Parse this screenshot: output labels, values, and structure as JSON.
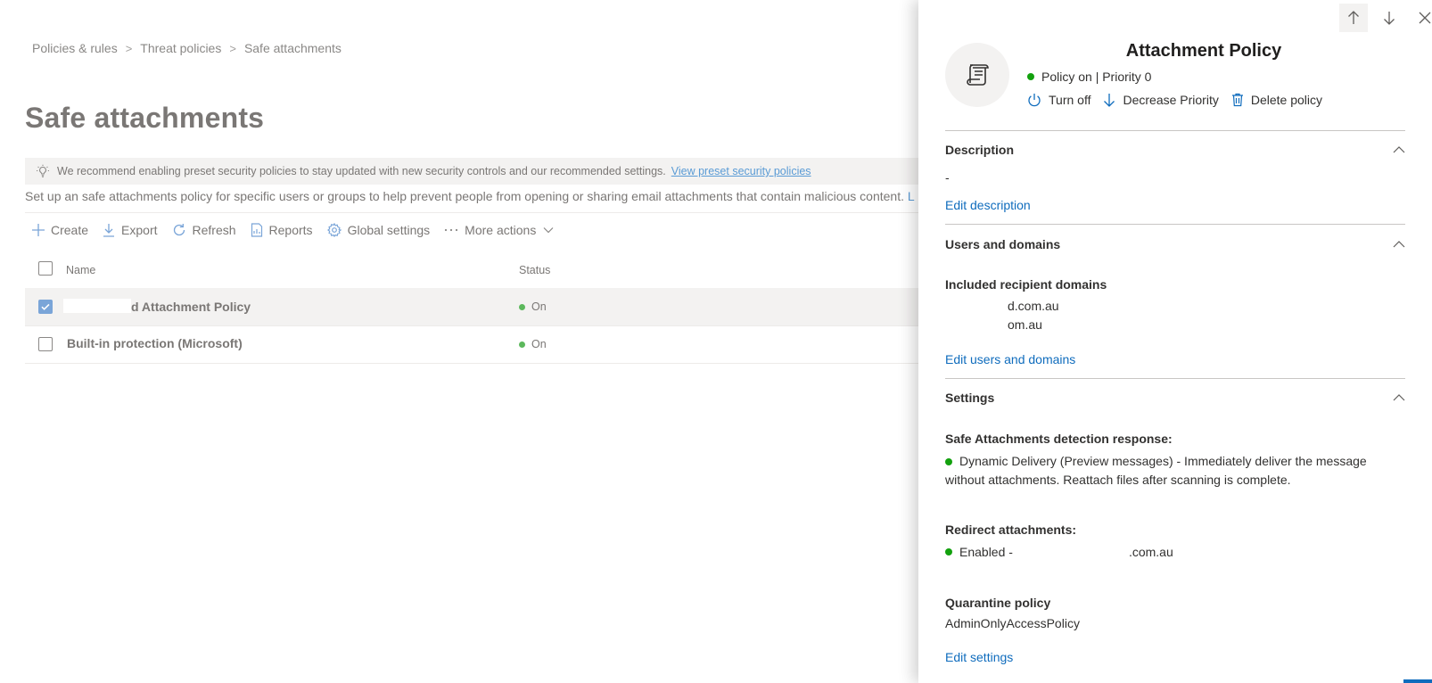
{
  "breadcrumb": {
    "items": [
      "Policies & rules",
      "Threat policies",
      "Safe attachments"
    ]
  },
  "page": {
    "title": "Safe attachments",
    "notice_text": "We recommend enabling preset security policies to stay updated with new security controls and our recommended settings.",
    "notice_link": "View preset security policies",
    "description": "Set up an safe attachments policy for specific users or groups to help prevent people from opening or sharing email attachments that contain malicious content.",
    "description_link": "L"
  },
  "toolbar": {
    "create": "Create",
    "export": "Export",
    "refresh": "Refresh",
    "reports": "Reports",
    "global_settings": "Global settings",
    "more_actions": "More actions"
  },
  "table": {
    "headers": {
      "name": "Name",
      "status": "Status"
    },
    "rows": [
      {
        "name": "d Attachment Policy",
        "status": "On",
        "selected": true
      },
      {
        "name": "Built-in protection (Microsoft)",
        "status": "On",
        "selected": false
      }
    ]
  },
  "panel": {
    "title": "Attachment Policy",
    "status": "Policy on | Priority 0",
    "actions": {
      "turn_off": "Turn off",
      "decrease_priority": "Decrease Priority",
      "delete_policy": "Delete policy"
    },
    "description": {
      "header": "Description",
      "value": "-",
      "edit": "Edit description"
    },
    "users": {
      "header": "Users and domains",
      "label": "Included recipient domains",
      "domains": [
        "d.com.au",
        "om.au"
      ],
      "edit": "Edit users and domains"
    },
    "settings": {
      "header": "Settings",
      "detection_label": "Safe Attachments detection response:",
      "detection_value": "Dynamic Delivery (Preview messages) - Immediately deliver the message without attachments. Reattach files after scanning is complete.",
      "redirect_label": "Redirect attachments:",
      "redirect_prefix": "Enabled -",
      "redirect_suffix": ".com.au",
      "quarantine_label": "Quarantine policy",
      "quarantine_value": "AdminOnlyAccessPolicy",
      "edit": "Edit settings"
    }
  },
  "colors": {
    "accent": "#0f6cbd",
    "status_green": "#13a10e",
    "dim_text": "#7a7775"
  },
  "icons": [
    "lightbulb-icon",
    "plus-icon",
    "download-icon",
    "refresh-icon",
    "report-icon",
    "gear-icon",
    "ellipsis-icon",
    "chevron-down-icon",
    "arrow-up-icon",
    "arrow-down-icon",
    "close-icon",
    "scroll-icon",
    "power-icon",
    "trash-icon",
    "chevron-up-icon",
    "checkmark-icon"
  ]
}
